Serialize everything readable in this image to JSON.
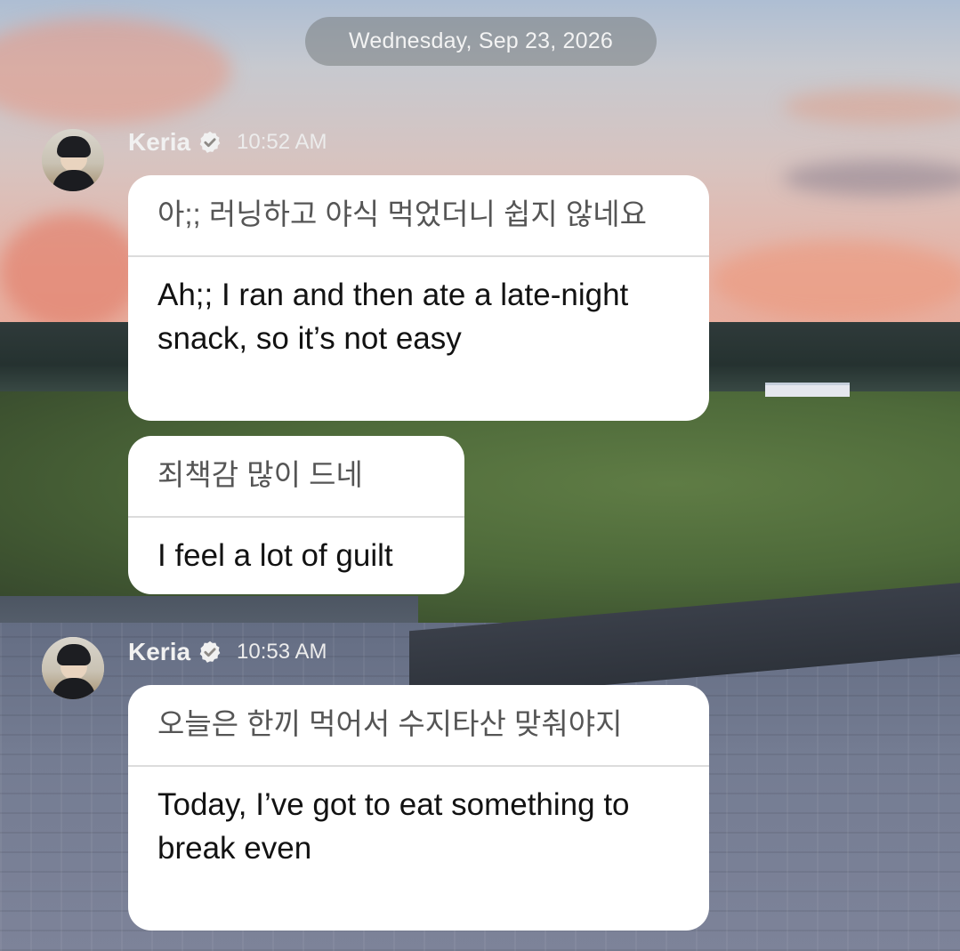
{
  "date_separator": "Wednesday, Sep 23, 2026",
  "messages": [
    {
      "sender": "Keria",
      "verified": true,
      "time": "10:52 AM",
      "bubbles": [
        {
          "original": "아;; 러닝하고 야식 먹었더니 쉽지 않네요",
          "translation": "Ah;; I ran and then ate a late-night snack, so it’s not easy"
        },
        {
          "original": "죄책감 많이 드네",
          "translation": "I feel a lot of guilt"
        }
      ]
    },
    {
      "sender": "Keria",
      "verified": true,
      "time": "10:53 AM",
      "bubbles": [
        {
          "original": "오늘은 한끼 먹어서 수지타산 맞춰야지",
          "translation": "Today, I’ve got to eat something to break even"
        }
      ]
    }
  ],
  "icons": {
    "verified": "verified-check-icon",
    "avatar": "avatar"
  },
  "colors": {
    "bubble_bg": "#ffffff",
    "original_text": "#555555",
    "translation_text": "#121212",
    "date_pill_bg": "rgba(120,126,128,0.55)"
  }
}
